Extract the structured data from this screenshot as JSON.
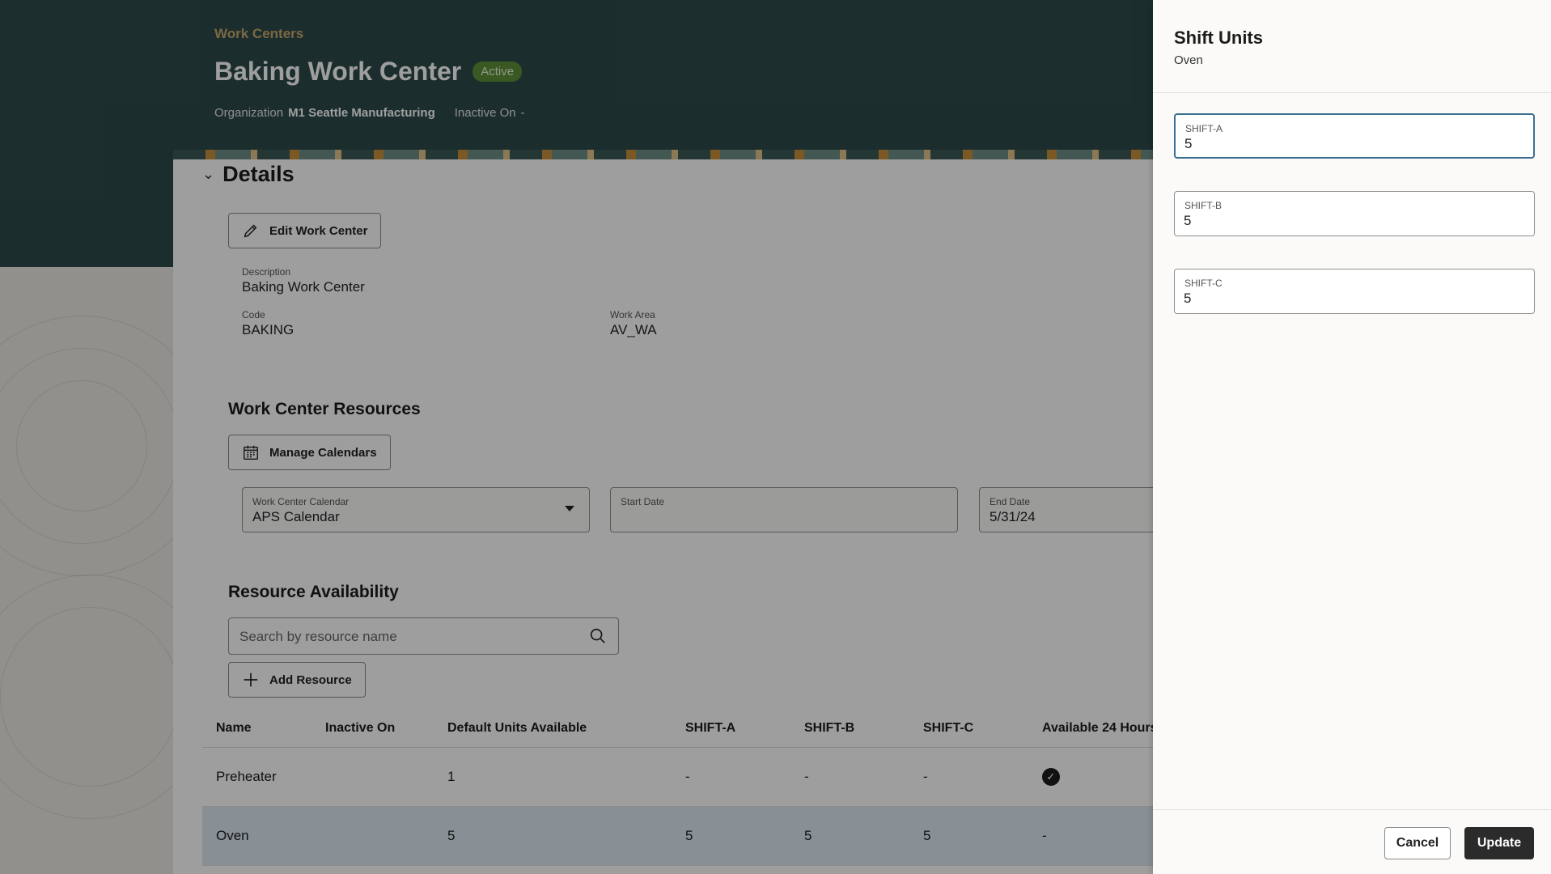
{
  "header": {
    "breadcrumb": "Work Centers",
    "title": "Baking Work Center",
    "status_badge": "Active",
    "organization_label": "Organization",
    "organization_value": "M1 Seattle Manufacturing",
    "inactive_on_label": "Inactive On",
    "inactive_on_value": "-"
  },
  "details": {
    "section_label": "Details",
    "edit_button": "Edit Work Center",
    "description_label": "Description",
    "description_value": "Baking Work Center",
    "code_label": "Code",
    "code_value": "BAKING",
    "work_area_label": "Work Area",
    "work_area_value": "AV_WA"
  },
  "resources": {
    "section_title": "Work Center Resources",
    "manage_calendars_button": "Manage Calendars",
    "calendar_label": "Work Center Calendar",
    "calendar_value": "APS Calendar",
    "start_date_label": "Start Date",
    "start_date_value": "",
    "end_date_label": "End Date",
    "end_date_value": "5/31/24"
  },
  "availability": {
    "section_title": "Resource Availability",
    "search_placeholder": "Search by resource name",
    "add_resource_button": "Add Resource",
    "columns": [
      "Name",
      "Inactive On",
      "Default Units Available",
      "SHIFT-A",
      "SHIFT-B",
      "SHIFT-C",
      "Available 24 Hours"
    ],
    "rows": [
      {
        "name": "Preheater",
        "inactive_on": "",
        "default_units": "1",
        "shift_a": "-",
        "shift_b": "-",
        "shift_c": "-",
        "available_24h": "check"
      },
      {
        "name": "Oven",
        "inactive_on": "",
        "default_units": "5",
        "shift_a": "5",
        "shift_b": "5",
        "shift_c": "5",
        "available_24h": "-"
      }
    ]
  },
  "drawer": {
    "title": "Shift Units",
    "subtitle": "Oven",
    "fields": [
      {
        "label": "SHIFT-A",
        "value": "5"
      },
      {
        "label": "SHIFT-B",
        "value": "5"
      },
      {
        "label": "SHIFT-C",
        "value": "5"
      }
    ],
    "cancel_button": "Cancel",
    "update_button": "Update"
  },
  "colors": {
    "header_bg": "#2e4a4a",
    "badge": "#5d8f38",
    "breadcrumb": "#c8a96e",
    "focus_border": "#3c6f8f",
    "primary_button": "#2b2b2b"
  }
}
